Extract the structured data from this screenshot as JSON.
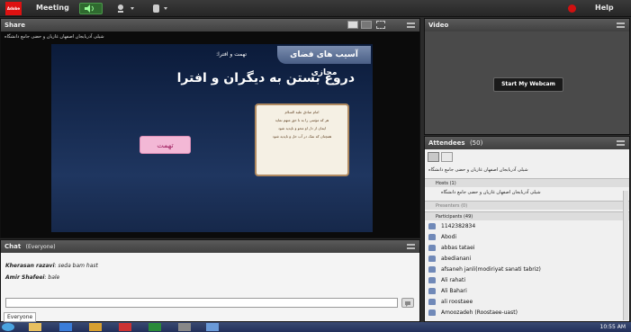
{
  "topbar": {
    "logo": "Adobe",
    "meeting_label": "Meeting",
    "help_label": "Help"
  },
  "share_pod": {
    "title": "Share",
    "presenter_line": "شیلی آذربایجان اصفهان غازیان و حضی جامع دانشگاه",
    "slide": {
      "banner": "آسیب های فضای مجازی",
      "subtitle": "تهمت و افترا:",
      "headline": "دروغ بستن به دیگران و افترا",
      "button_label": "تهمت",
      "poem_lines": [
        "امام صادق علیه السلام",
        "هر که مؤمنی را به نا حق متهم نماید",
        "ایمان از دل او محو و ناپدید شود",
        "همچنان که نمک در آب حل و ناپدید شود"
      ]
    }
  },
  "video_pod": {
    "title": "Video",
    "webcam_button": "Start My Webcam"
  },
  "attendees_pod": {
    "title": "Attendees",
    "count": "(50)",
    "self_line": "شیلی آذربایجان اصفهان غازیان و حضی جامع دانشگاه",
    "hosts_header": "Hosts (1)",
    "host_name": "شیلی آذربایجان اصفهان غازیان و حضی جامع دانشگاه",
    "presenters_header": "Presenters (0)",
    "participants_header": "Participants (49)",
    "participants": [
      "1142382834",
      "Abodi",
      "abbas tataei",
      "abedianani",
      "afsaneh janli(modiriyat sanati tabriz)",
      "Ali  rahati",
      "Ali Bahari",
      "ali roostaee",
      "Amoozadeh (Roostaee-uast)"
    ]
  },
  "chat_pod": {
    "title": "Chat",
    "scope": "(Everyone)",
    "messages": [
      {
        "sender": "Kherasan razavi",
        "text": "seda bam hast"
      },
      {
        "sender": "Amir Shafeei",
        "text": "bale"
      }
    ],
    "input_placeholder": "",
    "tab_label": "Everyone"
  },
  "taskbar": {
    "clock": "10:55 AM"
  },
  "colors": {
    "accent_red": "#d11010",
    "slide_bg": "#1f3660",
    "button_pink": "#f3b8d6"
  }
}
